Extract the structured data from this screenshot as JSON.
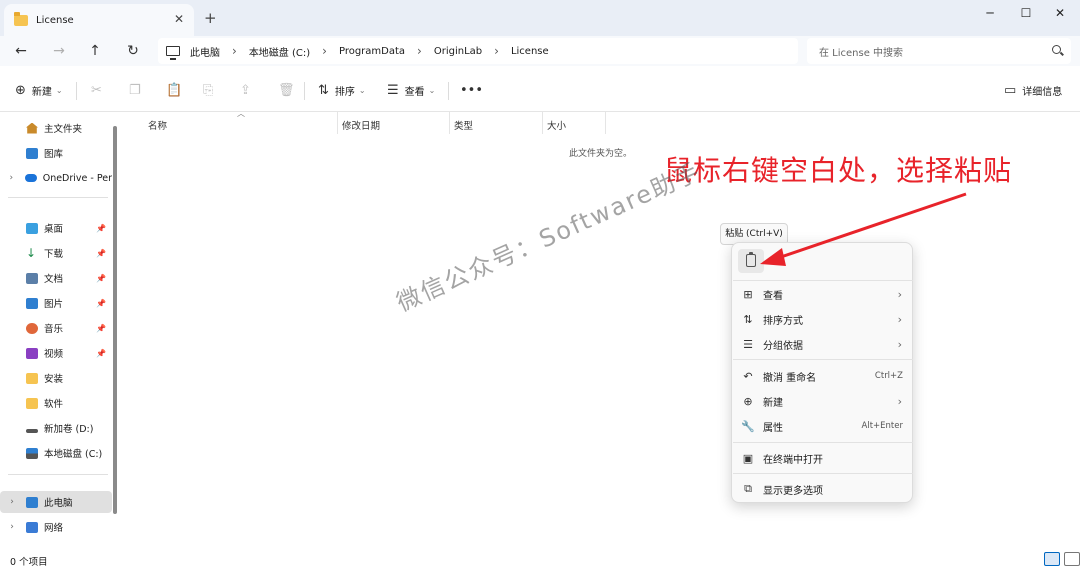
{
  "window": {
    "tab_title": "License",
    "tab_close": "✕",
    "new_tab": "+",
    "minimize": "─",
    "maximize": "☐",
    "close": "✕"
  },
  "nav": {
    "back": "←",
    "forward": "→",
    "up": "↑",
    "refresh": "↻"
  },
  "address": {
    "crumbs": [
      "此电脑",
      "本地磁盘 (C:)",
      "ProgramData",
      "OriginLab",
      "License"
    ],
    "separator": "›"
  },
  "search": {
    "placeholder": "在 License 中搜索"
  },
  "toolbar": {
    "new_label": "新建",
    "sort_label": "排序",
    "view_label": "查看",
    "more": "•••",
    "details_label": "详细信息"
  },
  "sidebar": {
    "items": [
      {
        "label": "主文件夹",
        "icon": "home-icon"
      },
      {
        "label": "图库",
        "icon": "gallery-icon"
      },
      {
        "label": "OneDrive - Per",
        "icon": "onedrive-icon"
      },
      {
        "label": "桌面",
        "icon": "desktop-icon"
      },
      {
        "label": "下载",
        "icon": "download-icon"
      },
      {
        "label": "文档",
        "icon": "documents-icon"
      },
      {
        "label": "图片",
        "icon": "pictures-icon"
      },
      {
        "label": "音乐",
        "icon": "music-icon"
      },
      {
        "label": "视频",
        "icon": "videos-icon"
      },
      {
        "label": "安装",
        "icon": "folder-icon"
      },
      {
        "label": "软件",
        "icon": "folder-icon"
      },
      {
        "label": "新加卷 (D:)",
        "icon": "drive-icon"
      },
      {
        "label": "本地磁盘 (C:)",
        "icon": "drive-icon"
      },
      {
        "label": "此电脑",
        "icon": "pc-icon"
      },
      {
        "label": "网络",
        "icon": "network-icon"
      }
    ]
  },
  "columns": [
    "名称",
    "修改日期",
    "类型",
    "大小"
  ],
  "empty_message": "此文件夹为空。",
  "annotation": "鼠标右键空白处，选择粘贴",
  "watermark": "微信公众号：Software助手",
  "tooltip": "粘贴 (Ctrl+V)",
  "context_menu": {
    "items": [
      {
        "label": "查看",
        "shortcut": "",
        "submenu": true,
        "icon": "view-icon"
      },
      {
        "label": "排序方式",
        "shortcut": "",
        "submenu": true,
        "icon": "sort-icon"
      },
      {
        "label": "分组依据",
        "shortcut": "",
        "submenu": true,
        "icon": "group-icon"
      },
      {
        "label": "撤消 重命名",
        "shortcut": "Ctrl+Z",
        "submenu": false,
        "icon": "undo-icon"
      },
      {
        "label": "新建",
        "shortcut": "",
        "submenu": true,
        "icon": "new-icon"
      },
      {
        "label": "属性",
        "shortcut": "Alt+Enter",
        "submenu": false,
        "icon": "properties-icon"
      },
      {
        "label": "在终端中打开",
        "shortcut": "",
        "submenu": false,
        "icon": "terminal-icon"
      },
      {
        "label": "显示更多选项",
        "shortcut": "",
        "submenu": false,
        "icon": "more-options-icon"
      }
    ],
    "submenu_arrow": "›"
  },
  "status": {
    "count": "0 个项目"
  },
  "colors": {
    "accent": "#0067c0",
    "annotation_red": "#e8232a"
  }
}
